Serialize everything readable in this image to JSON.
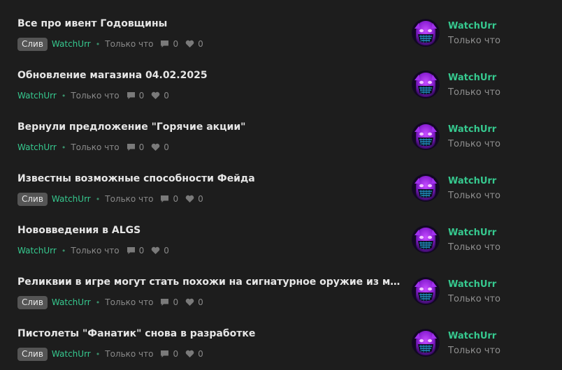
{
  "colors": {
    "background": "#1d1d1d",
    "title": "#e6e6e6",
    "author": "#36c98f",
    "muted": "#8a8a8a",
    "tag_bg": "#555555"
  },
  "threads": [
    {
      "title": "Все про ивент Годовщины",
      "tag": "Слив",
      "author": "WatchUrr",
      "time": "Только что",
      "replies": "0",
      "likes": "0",
      "last_author": "WatchUrr",
      "last_time": "Только что"
    },
    {
      "title": "Обновление магазина 04.02.2025",
      "tag": "",
      "author": "WatchUrr",
      "time": "Только что",
      "replies": "0",
      "likes": "0",
      "last_author": "WatchUrr",
      "last_time": "Только что"
    },
    {
      "title": "Вернули предложение \"Горячие акции\"",
      "tag": "",
      "author": "WatchUrr",
      "time": "Только что",
      "replies": "0",
      "likes": "0",
      "last_author": "WatchUrr",
      "last_time": "Только что"
    },
    {
      "title": "Известны возможные способности Фейда",
      "tag": "Слив",
      "author": "WatchUrr",
      "time": "Только что",
      "replies": "0",
      "likes": "0",
      "last_author": "WatchUrr",
      "last_time": "Только что"
    },
    {
      "title": "Нововведения в ALGS",
      "tag": "",
      "author": "WatchUrr",
      "time": "Только что",
      "replies": "0",
      "likes": "0",
      "last_author": "WatchUrr",
      "last_time": "Только что"
    },
    {
      "title": "Реликвии в игре могут стать похожи на сигнатурное оружие из мобильной…",
      "tag": "Слив",
      "author": "WatchUrr",
      "time": "Только что",
      "replies": "0",
      "likes": "0",
      "last_author": "WatchUrr",
      "last_time": "Только что"
    },
    {
      "title": "Пистолеты \"Фанатик\" снова в разработке",
      "tag": "Слив",
      "author": "WatchUrr",
      "time": "Только что",
      "replies": "0",
      "likes": "0",
      "last_author": "WatchUrr",
      "last_time": "Только что"
    }
  ],
  "icons": {
    "replies": "comment-icon",
    "likes": "heart-icon",
    "avatar": "avatar-purple-masked-character"
  }
}
